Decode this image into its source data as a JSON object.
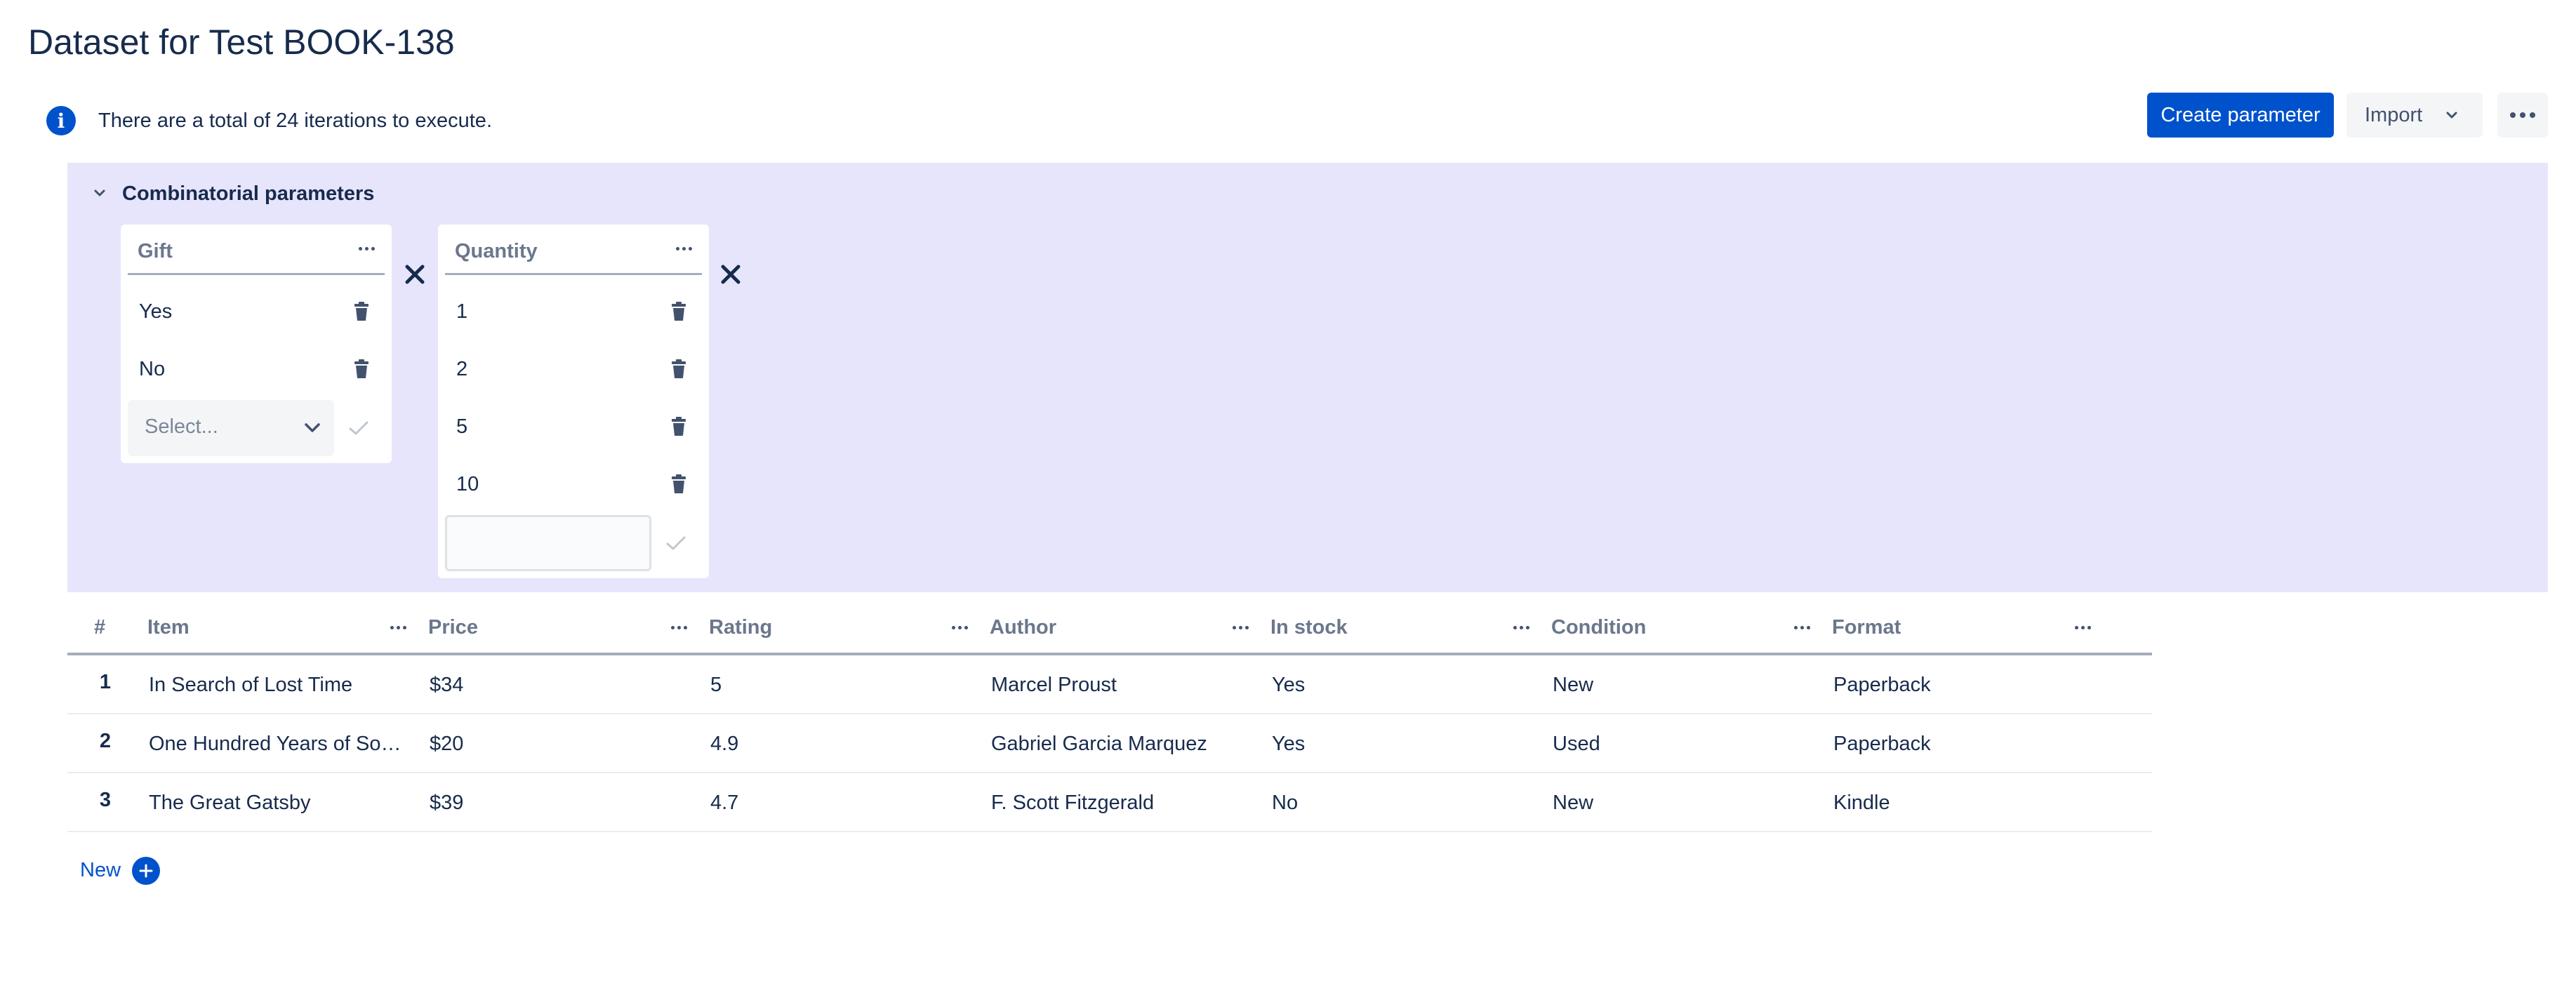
{
  "page": {
    "title": "Dataset for Test BOOK-138"
  },
  "info": {
    "icon": "info-icon",
    "icon_glyph": "i",
    "text": "There are a total of 24 iterations to execute."
  },
  "toolbar": {
    "create_label": "Create parameter",
    "import_label": "Import",
    "more_icon": "more-horizontal-icon"
  },
  "combinatorial": {
    "title": "Combinatorial parameters",
    "background_color": "#e7e5fc",
    "parameters": [
      {
        "name": "Gift",
        "values": [
          "Yes",
          "No"
        ],
        "new_value_placeholder": "Select..."
      },
      {
        "name": "Quantity",
        "values": [
          "1",
          "2",
          "5",
          "10"
        ],
        "new_value_placeholder": ""
      }
    ]
  },
  "table": {
    "columns": [
      "#",
      "Item",
      "Price",
      "Rating",
      "Author",
      "In stock",
      "Condition",
      "Format"
    ],
    "rows": [
      {
        "index": "1",
        "cells": [
          "In Search of Lost Time",
          "$34",
          "5",
          "Marcel Proust",
          "Yes",
          "New",
          "Paperback"
        ]
      },
      {
        "index": "2",
        "cells": [
          "One Hundred Years of Solitude",
          "$20",
          "4.9",
          "Gabriel Garcia Marquez",
          "Yes",
          "Used",
          "Paperback"
        ]
      },
      {
        "index": "3",
        "cells": [
          "The Great Gatsby",
          "$39",
          "4.7",
          "F. Scott Fitzgerald",
          "No",
          "New",
          "Kindle"
        ]
      }
    ]
  },
  "new_row": {
    "label": "New",
    "icon": "plus-circle-icon"
  },
  "colors": {
    "primary": "#0052cc",
    "text": "#172b4d",
    "muted": "#6b778c"
  }
}
